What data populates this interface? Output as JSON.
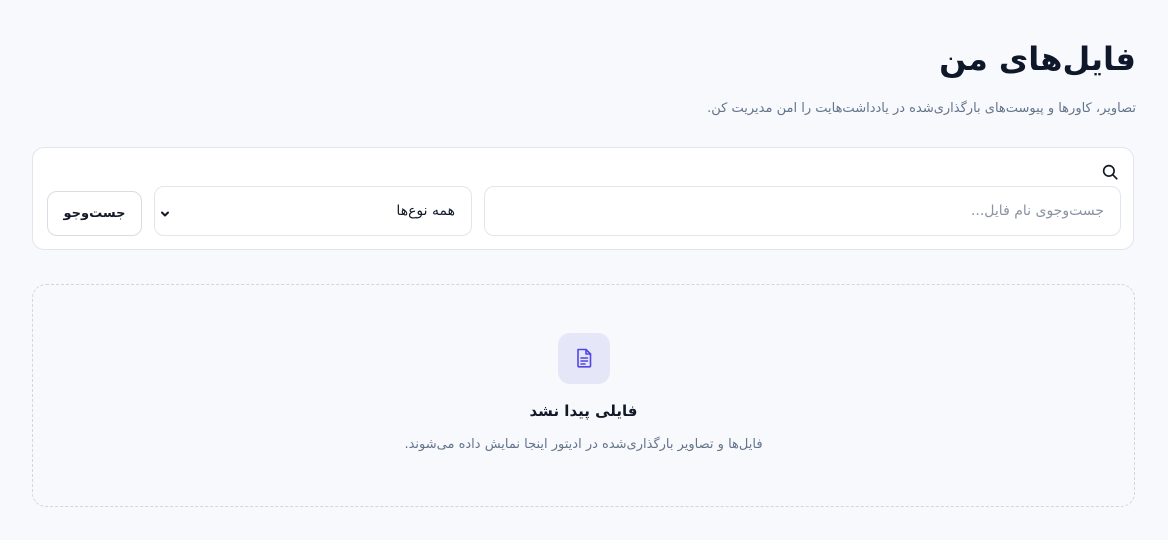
{
  "header": {
    "title": "فایل‌های من",
    "subtitle": "تصاویر، کاورها و پیوست‌های بارگذاری‌شده در یادداشت‌هایت را امن مدیریت کن."
  },
  "search": {
    "placeholder": "جست‌وجوی نام فایل...",
    "value": "",
    "type_filter": {
      "selected": "همه نوع‌ها"
    },
    "button_label": "جست‌وجو",
    "icon": "search-icon"
  },
  "empty_state": {
    "icon": "file-text-icon",
    "title": "فایلی پیدا نشد",
    "description": "فایل‌ها و تصاویر بارگذاری‌شده در ادیتور اینجا نمایش داده می‌شوند."
  },
  "colors": {
    "background": "#f8f9fc",
    "card": "#ffffff",
    "border": "#e2e5ec",
    "accent": "#4f46e5",
    "accent_soft": "#e5e7f8",
    "text": "#111827",
    "muted": "#64748b"
  }
}
